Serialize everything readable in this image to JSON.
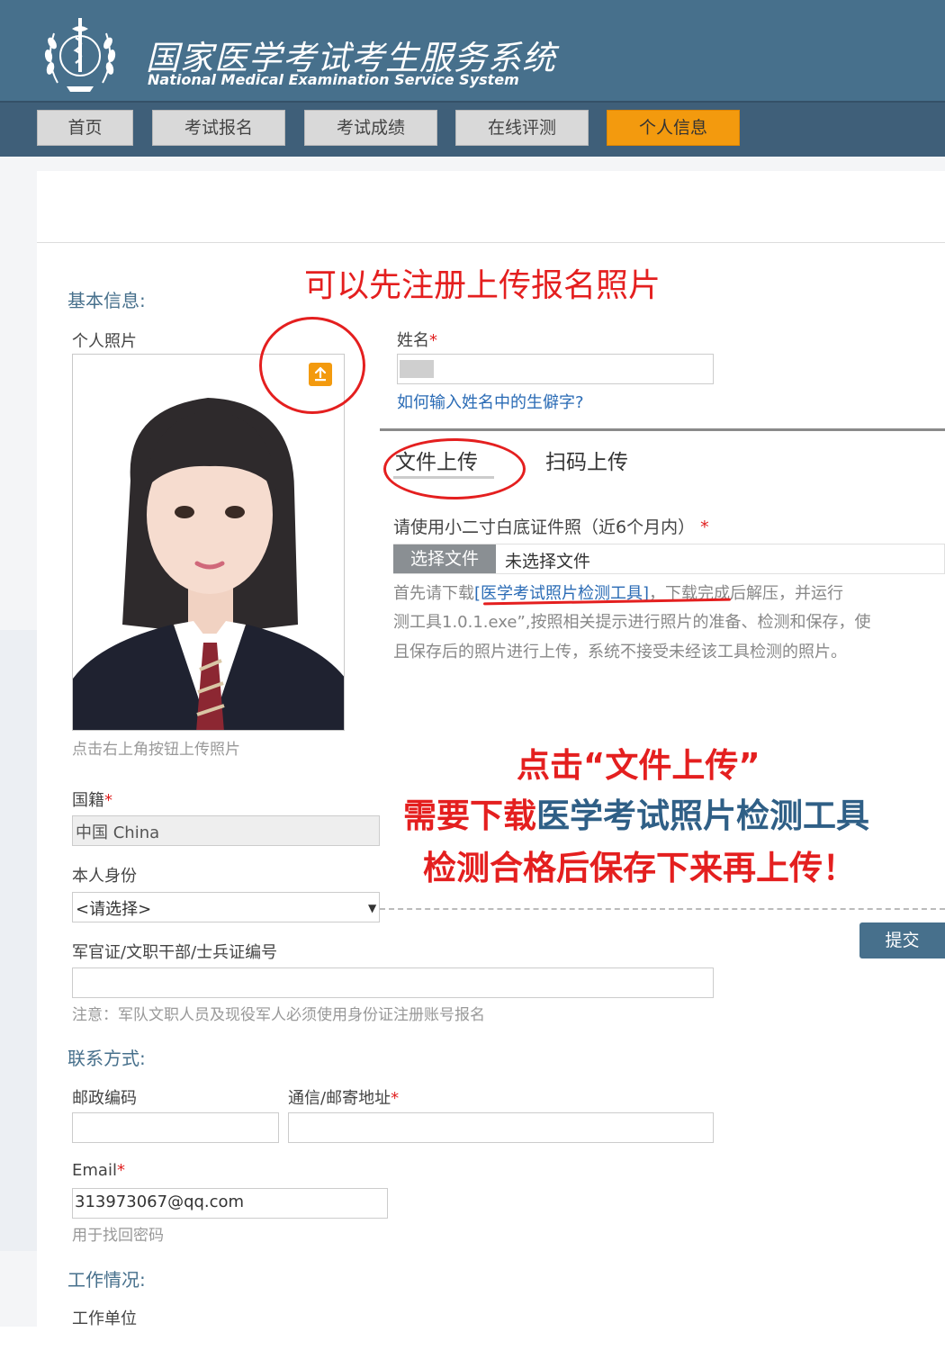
{
  "header": {
    "title": "国家医学考试考生服务系统",
    "subtitle": "National Medical Examination Service System"
  },
  "nav": {
    "items": [
      {
        "label": "首页",
        "active": false
      },
      {
        "label": "考试报名",
        "active": false
      },
      {
        "label": "考试成绩",
        "active": false
      },
      {
        "label": "在线评测",
        "active": false
      },
      {
        "label": "个人信息",
        "active": true
      }
    ]
  },
  "basic_info": {
    "section_title": "基本信息:",
    "photo_label": "个人照片",
    "photo_hint": "点击右上角按钮上传照片",
    "name_label": "姓名",
    "required_mark": "*",
    "rare_char_link": "如何输入姓名中的生僻字?",
    "nationality_label": "国籍",
    "nationality_value": "中国 China",
    "identity_label": "本人身份",
    "identity_value": "<请选择>",
    "military_id_label": "军官证/文职干部/士兵证编号",
    "military_note": "注意：军队文职人员及现役军人必须使用身份证注册账号报名"
  },
  "photo_upload": {
    "tab_file": "文件上传",
    "tab_scan": "扫码上传",
    "requirement": "请使用小二寸白底证件照（近6个月内）",
    "choose_file_label": "选择文件",
    "no_file_text": "未选择文件",
    "instruction_prefix": "首先请下载",
    "tool_link": "[医学考试照片检测工具]",
    "instruction_line1_rest": "，下载完成后解压，并运行",
    "instruction_line2": "测工具1.0.1.exe”,按照相关提示进行照片的准备、检测和保存，使",
    "instruction_line3": "且保存后的照片进行上传，系统不接受未经该工具检测的照片。",
    "submit_label": "提交"
  },
  "contact": {
    "section_title": "联系方式:",
    "postcode_label": "邮政编码",
    "address_label": "通信/邮寄地址",
    "email_label": "Email",
    "email_value": "313973067@qq.com",
    "email_hint": "用于找回密码"
  },
  "work": {
    "section_title": "工作情况:",
    "employer_label": "工作单位"
  },
  "annotations": {
    "top_note": "可以先注册上传报名照片",
    "line1": "点击“文件上传”",
    "line2_a": "需要下载",
    "line2_b": "医学考试照片检测工具",
    "line3": "检测合格后保存下来再上传！"
  },
  "colors": {
    "header_bg": "#47708c",
    "nav_active": "#f39a0e",
    "annotation_red": "#e41f1f",
    "link_blue": "#2a6bb5"
  }
}
